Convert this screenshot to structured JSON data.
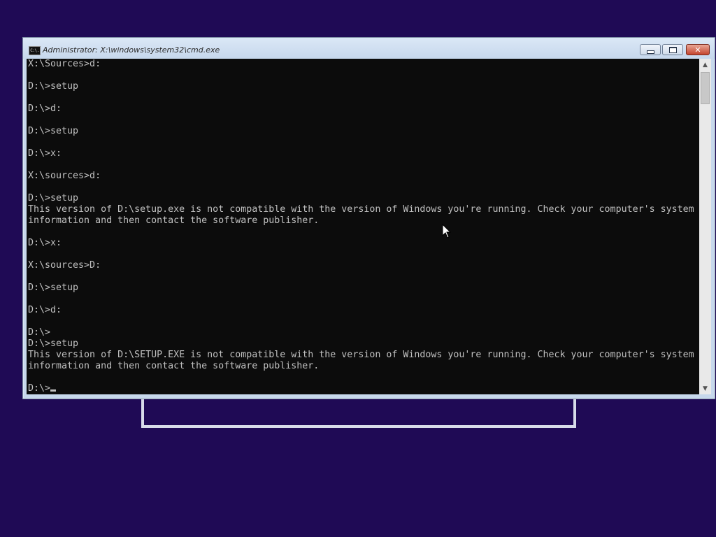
{
  "window": {
    "title": "Administrator: X:\\windows\\system32\\cmd.exe",
    "icon_label": "C:\\.",
    "buttons": {
      "minimize": "minimize-icon",
      "maximize": "maximize-icon",
      "close": "✕"
    }
  },
  "console": {
    "lines": [
      "X:\\Sources>d:",
      "",
      "D:\\>setup",
      "",
      "D:\\>d:",
      "",
      "D:\\>setup",
      "",
      "D:\\>x:",
      "",
      "X:\\sources>d:",
      "",
      "D:\\>setup",
      "This version of D:\\setup.exe is not compatible with the version of Windows you're running. Check your computer's system",
      "information and then contact the software publisher.",
      "",
      "D:\\>x:",
      "",
      "X:\\sources>D:",
      "",
      "D:\\>setup",
      "",
      "D:\\>d:",
      "",
      "D:\\>",
      "D:\\>setup",
      "This version of D:\\SETUP.EXE is not compatible with the version of Windows you're running. Check your computer's system",
      "information and then contact the software publisher.",
      ""
    ],
    "current_prompt": "D:\\>"
  },
  "scrollbar": {
    "up_icon": "▲",
    "down_icon": "▼"
  },
  "colors": {
    "desktop_background": "#1f0a55",
    "console_background": "#0c0c0c",
    "console_text": "#c0c0c0",
    "titlebar": "#c6d7ec",
    "close_button": "#c4442e"
  }
}
